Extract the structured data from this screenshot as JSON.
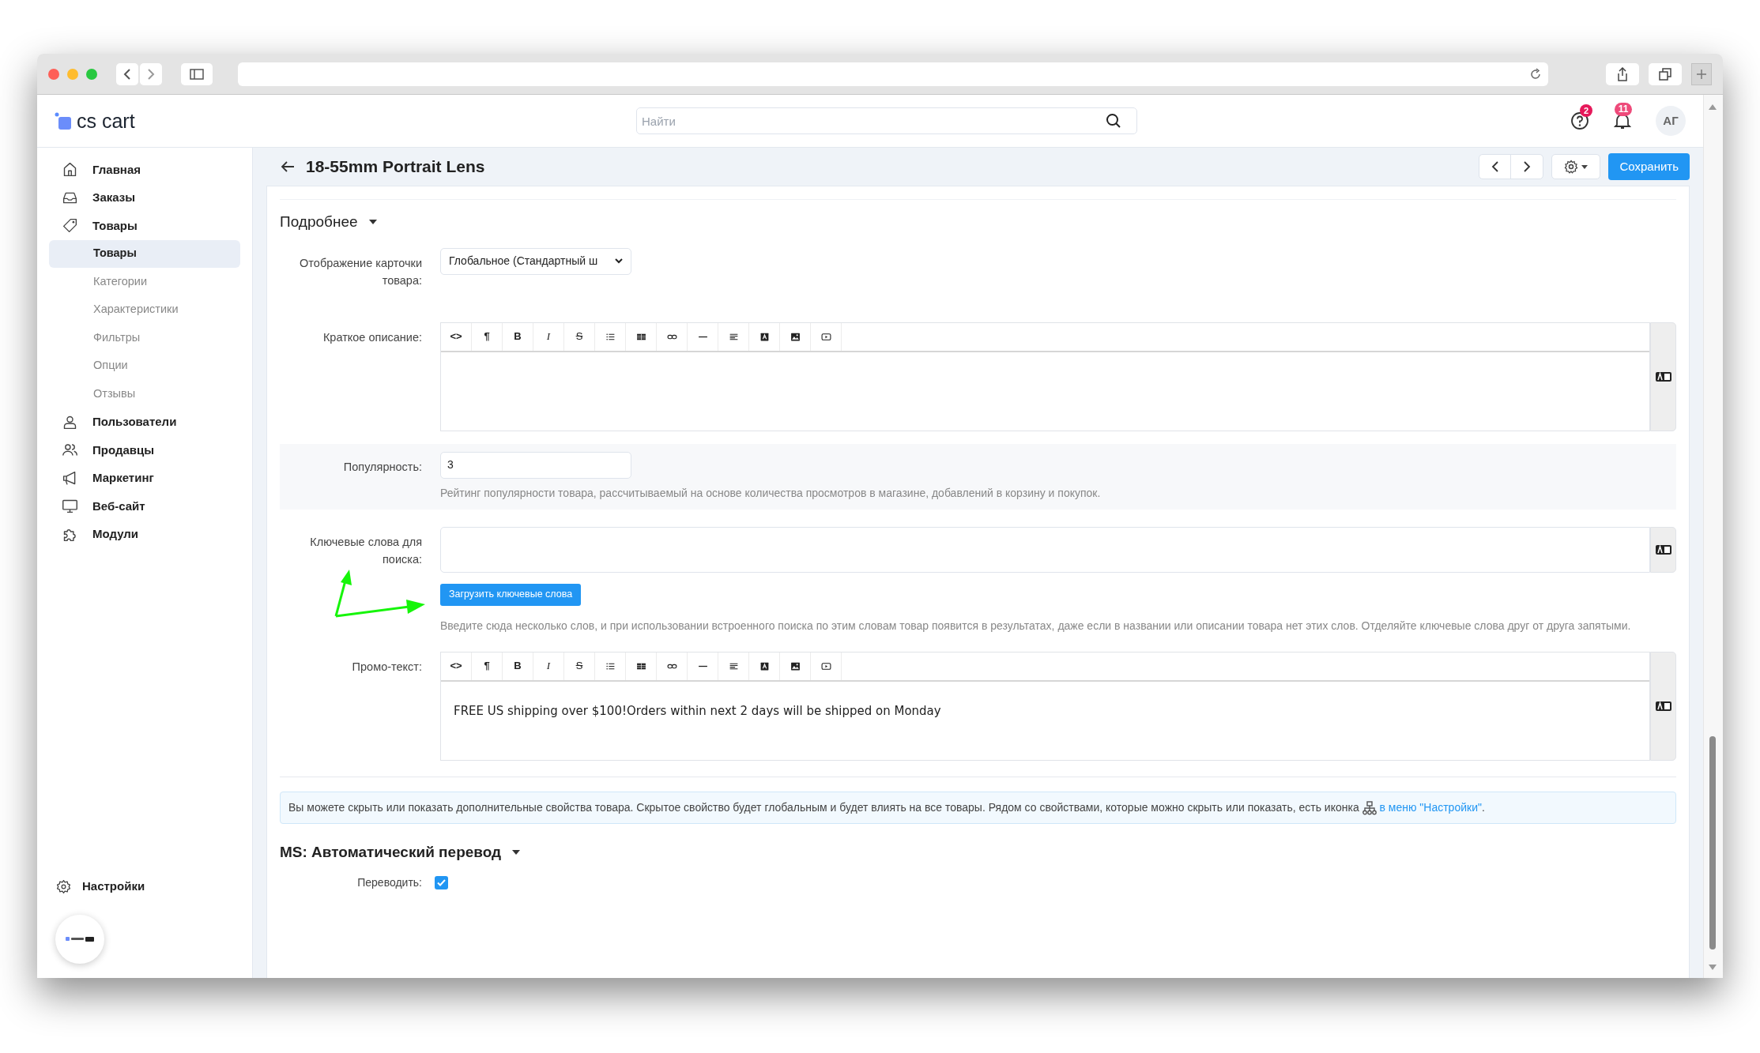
{
  "header": {
    "logo": "cs cart",
    "search": {
      "placeholder": "Найти"
    },
    "help_badge": "2",
    "notifications_badge": "11",
    "avatar": "АГ"
  },
  "sidebar": {
    "items": [
      {
        "label": "Главная"
      },
      {
        "label": "Заказы"
      },
      {
        "label": "Товары",
        "children": [
          {
            "label": "Товары",
            "selected": true
          },
          {
            "label": "Категории",
            "selected": false
          },
          {
            "label": "Характеристики",
            "selected": false
          },
          {
            "label": "Фильтры",
            "selected": false
          },
          {
            "label": "Опции",
            "selected": false
          },
          {
            "label": "Отзывы",
            "selected": false
          }
        ]
      },
      {
        "label": "Пользователи"
      },
      {
        "label": "Продавцы"
      },
      {
        "label": "Маркетинг"
      },
      {
        "label": "Веб-сайт"
      },
      {
        "label": "Модули"
      }
    ],
    "footer": {
      "label": "Настройки"
    }
  },
  "page": {
    "title": "18-55mm Portrait Lens",
    "save_button": "Сохранить"
  },
  "details": {
    "title": "Подробнее",
    "fields": [
      {
        "kind": "select",
        "label": "Отображение карточки товара:",
        "value": "Глобальное (Стандартный ш"
      },
      {
        "kind": "editor",
        "label": "Краткое описание:",
        "toolbar": [
          {
            "kind": "text",
            "label": "<>"
          },
          {
            "kind": "text",
            "label": "¶"
          },
          {
            "kind": "bold",
            "label": "B"
          },
          {
            "kind": "italic",
            "label": "I"
          },
          {
            "kind": "strike",
            "label": "S"
          },
          {
            "kind": "list"
          },
          {
            "kind": "table"
          },
          {
            "kind": "link"
          },
          {
            "kind": "rule"
          },
          {
            "kind": "align"
          },
          {
            "kind": "color"
          },
          {
            "kind": "image"
          },
          {
            "kind": "video"
          }
        ]
      },
      {
        "kind": "input",
        "label": "Популярность:",
        "value": "3",
        "help": "Рейтинг популярности товара, рассчитываемый на основе количества просмотров в магазине, добавлений в корзину и покупок."
      },
      {
        "kind": "textarea",
        "label": "Ключевые слова для поиска:",
        "button": "Загрузить ключевые слова",
        "help": "Введите сюда несколько слов, и при использовании встроенного поиска по этим словам товар появится в результатах, даже если в названии или описании товара нет этих слов. Отделяйте ключевые слова друг от друга запятыми."
      },
      {
        "kind": "editor",
        "label": "Промо-текст:",
        "value": "FREE US shipping over $100!Orders within next 2 days will be shipped on Monday",
        "toolbar": [
          {
            "kind": "text",
            "label": "<>"
          },
          {
            "kind": "text",
            "label": "¶"
          },
          {
            "kind": "bold",
            "label": "B"
          },
          {
            "kind": "italic",
            "label": "I"
          },
          {
            "kind": "strike",
            "label": "S"
          },
          {
            "kind": "list"
          },
          {
            "kind": "table"
          },
          {
            "kind": "link"
          },
          {
            "kind": "rule"
          },
          {
            "kind": "align"
          },
          {
            "kind": "color"
          },
          {
            "kind": "image"
          },
          {
            "kind": "video"
          }
        ]
      }
    ]
  },
  "info": {
    "text": "Вы можете скрыть или показать дополнительные свойства товара. Скрытое свойство будет глобальным и будет влиять на все товары. Рядом со свойствами, которые можно скрыть или показать, есть иконка",
    "link": "в меню \"Настройки\"",
    "end": "."
  },
  "translate": {
    "title": "MS: Автоматический перевод",
    "label": "Переводить:",
    "checked": true
  }
}
